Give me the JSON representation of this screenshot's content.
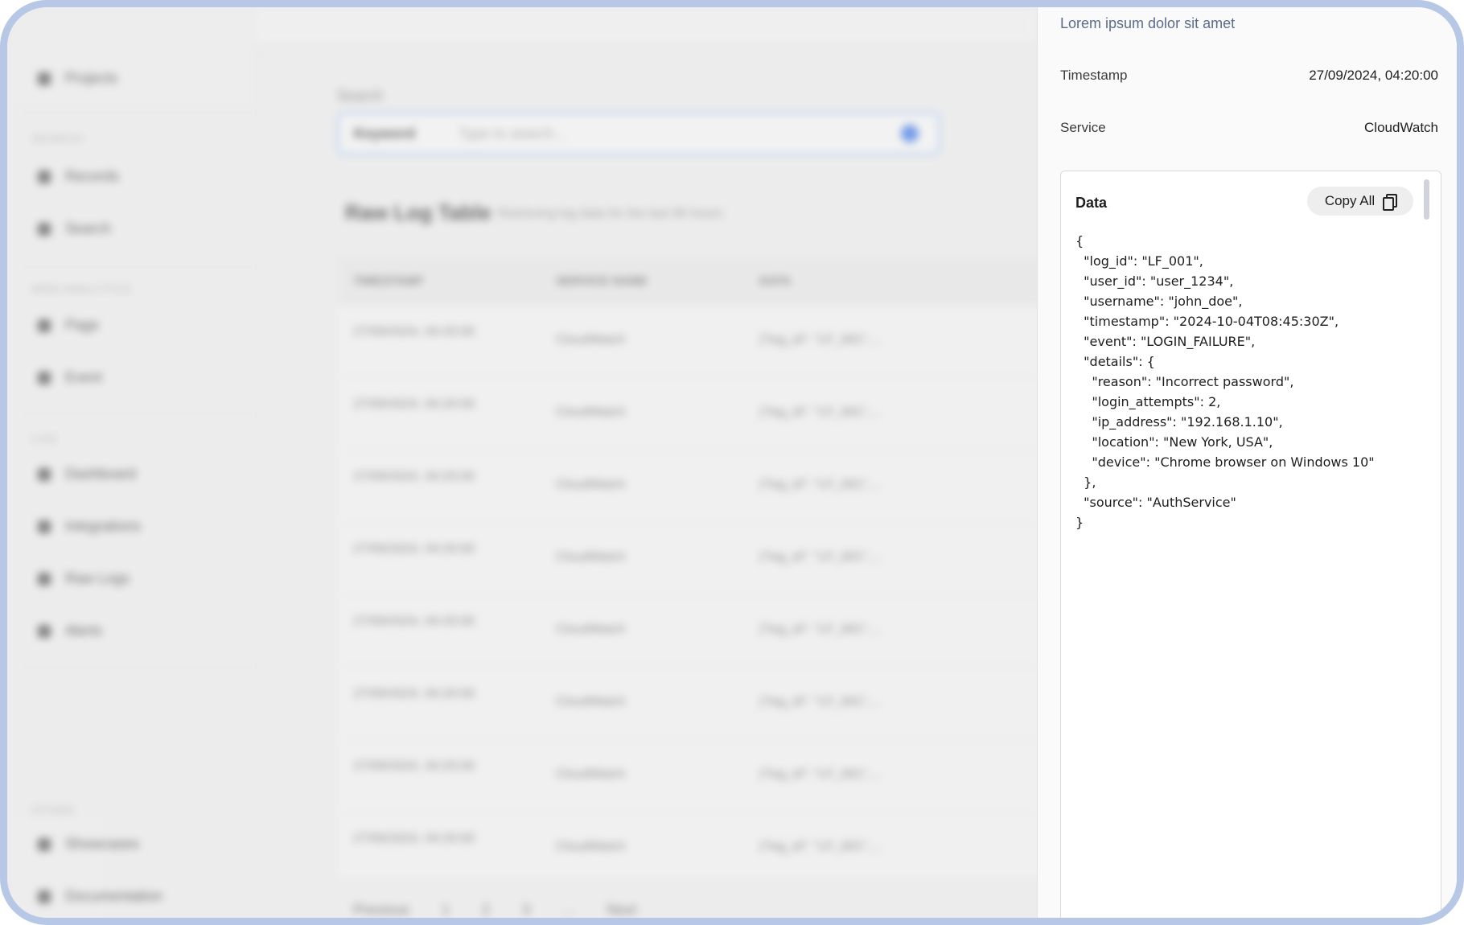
{
  "sidebar": {
    "top_item": "Projects",
    "groups": [
      {
        "label": "SEARCH",
        "items": [
          "Records",
          "Search"
        ]
      },
      {
        "label": "WEB ANALYTICS",
        "items": [
          "Page",
          "Event"
        ]
      },
      {
        "label": "LOG",
        "items": [
          "Dashboard",
          "Integrations",
          "Raw Logs",
          "Alerts"
        ]
      },
      {
        "label": "OTHER",
        "items": [
          "Showcases",
          "Documentation"
        ]
      }
    ]
  },
  "search": {
    "label": "Search",
    "mode": "Keyword",
    "placeholder": "Type to search..."
  },
  "table": {
    "title": "Raw Log Table",
    "subtitle": "Retrieving log data for the last 96 hours",
    "columns": [
      "TIMESTAMP",
      "SERVICE NAME",
      "DATA"
    ],
    "rows": [
      [
        "27/09/2024, 04:20:00",
        "CloudWatch",
        "{\"log_id\": \"LF_001\",..."
      ],
      [
        "27/09/2024, 04:20:00",
        "CloudWatch",
        "{\"log_id\": \"LF_001\",..."
      ],
      [
        "27/09/2024, 04:20:00",
        "CloudWatch",
        "{\"log_id\": \"LF_001\",..."
      ],
      [
        "27/09/2024, 04:20:00",
        "CloudWatch",
        "{\"log_id\": \"LF_001\",..."
      ],
      [
        "27/09/2024, 04:20:00",
        "CloudWatch",
        "{\"log_id\": \"LF_001\",..."
      ],
      [
        "27/09/2024, 04:20:00",
        "CloudWatch",
        "{\"log_id\": \"LF_001\",..."
      ],
      [
        "27/09/2024, 04:20:00",
        "CloudWatch",
        "{\"log_id\": \"LF_001\",..."
      ],
      [
        "27/09/2024, 04:20:00",
        "CloudWatch",
        "{\"log_id\": \"LF_001\",..."
      ]
    ],
    "pagination": {
      "previous": "Previous",
      "pages": [
        "1",
        "2",
        "3",
        "..."
      ],
      "next": "Next"
    }
  },
  "detail": {
    "description": "Lorem ipsum dolor sit amet",
    "timestamp_label": "Timestamp",
    "timestamp_value": "27/09/2024, 04:20:00",
    "service_label": "Service",
    "service_value": "CloudWatch",
    "data_title": "Data",
    "copy_label": "Copy All",
    "json_lines": [
      "{",
      "  \"log_id\": \"LF_001\",",
      "  \"user_id\": \"user_1234\",",
      "  \"username\": \"john_doe\",",
      "  \"timestamp\": \"2024-10-04T08:45:30Z\",",
      "  \"event\": \"LOGIN_FAILURE\",",
      "  \"details\": {",
      "    \"reason\": \"Incorrect password\",",
      "    \"login_attempts\": 2,",
      "    \"ip_address\": \"192.168.1.10\",",
      "    \"location\": \"New York, USA\",",
      "    \"device\": \"Chrome browser on Windows 10\"",
      "  },",
      "  \"source\": \"AuthService\"",
      "}"
    ]
  },
  "colors": {
    "frame_border": "#b6c8e6",
    "accent": "#2f6ee8"
  }
}
